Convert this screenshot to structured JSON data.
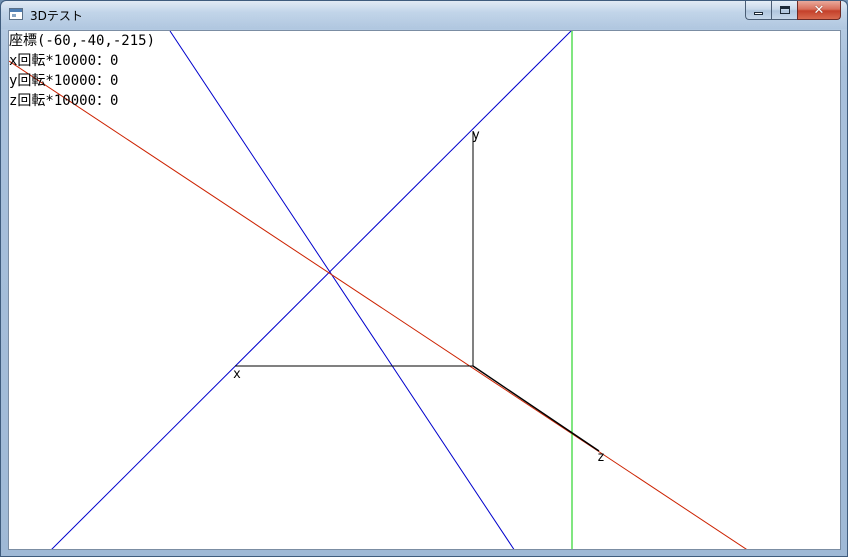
{
  "window": {
    "title": "3Dテスト",
    "close_glyph": "✕"
  },
  "icons": {
    "app": "app-window-icon",
    "minimize": "minimize-icon",
    "maximize": "maximize-icon",
    "close": "close-icon"
  },
  "hud": {
    "coords": "座標(-60,-40,-215)",
    "x_rotation": "x回転*10000：0",
    "y_rotation": "y回転*10000：0",
    "z_rotation": "z回転*10000：0"
  },
  "axes": {
    "x_label": "x",
    "y_label": "y",
    "z_label": "z"
  },
  "colors": {
    "blue_lines": "#0000cc",
    "red_line": "#cc2200",
    "green_line": "#00cc00",
    "axes": "#000000"
  }
}
